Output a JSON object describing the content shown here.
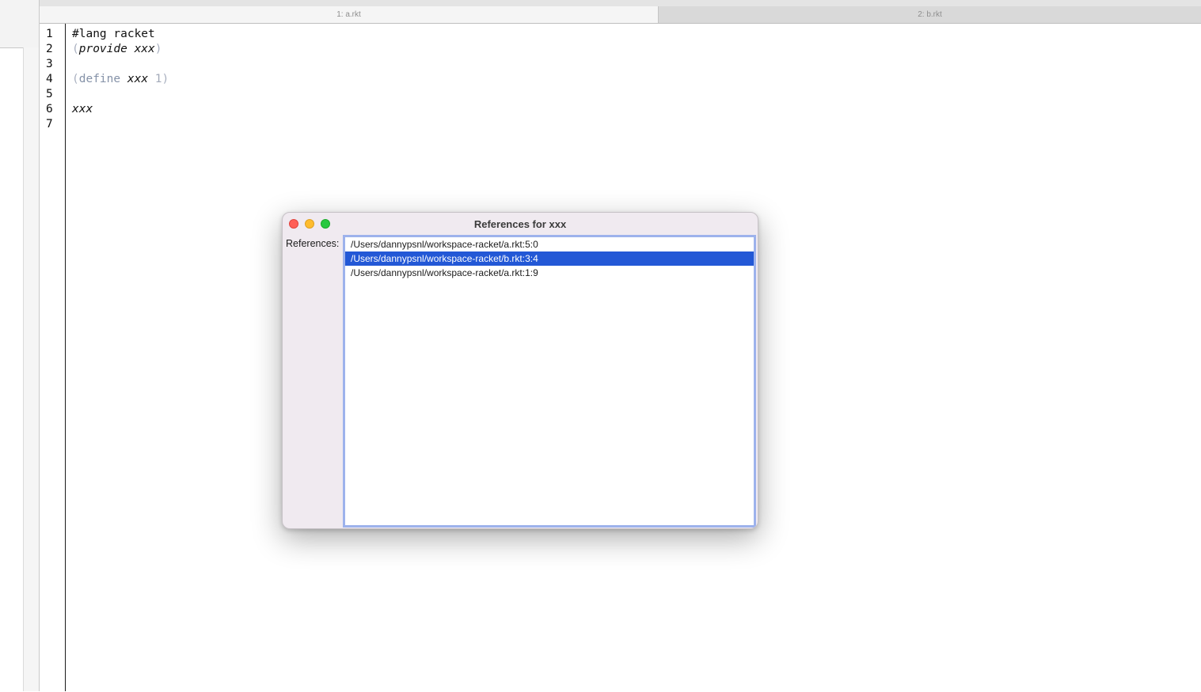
{
  "tabs": [
    {
      "label": "1: a.rkt"
    },
    {
      "label": "2: b.rkt"
    }
  ],
  "editor": {
    "line_numbers": [
      "1",
      "2",
      "3",
      "4",
      "5",
      "6",
      "7"
    ],
    "lines": {
      "l1": "#lang racket",
      "l2_open": "(",
      "l2_kw": "provide",
      "l2_id": "xxx",
      "l2_close": ")",
      "l4_open": "(",
      "l4_kw": "define",
      "l4_id": "xxx",
      "l4_num": "1",
      "l4_close": ")",
      "l6_id": "xxx"
    }
  },
  "dialog": {
    "title": "References for xxx",
    "label": "References:",
    "items": [
      "/Users/dannypsnl/workspace-racket/a.rkt:5:0",
      "/Users/dannypsnl/workspace-racket/b.rkt:3:4",
      "/Users/dannypsnl/workspace-racket/a.rkt:1:9"
    ],
    "selected_index": 1
  },
  "colors": {
    "selection": "#2358d6",
    "list_focus_ring": "#9db2ec",
    "keyword": "#8592a8",
    "paren": "#a9b0c0"
  }
}
